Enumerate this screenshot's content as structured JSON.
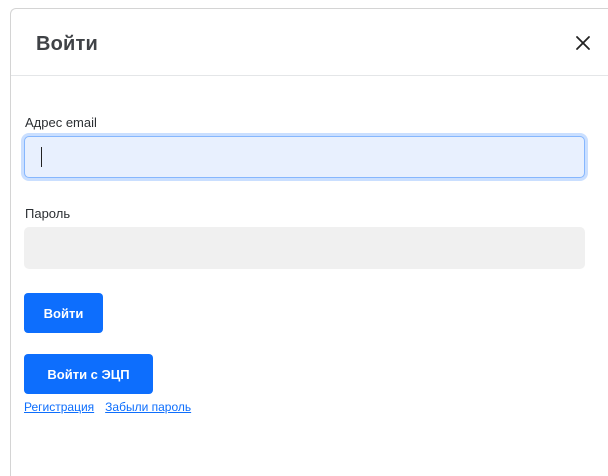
{
  "modal": {
    "title": "Войти",
    "close_icon": "close-icon"
  },
  "form": {
    "email_label": "Адрес email",
    "email_value": "",
    "password_label": "Пароль",
    "password_value": "",
    "login_button": "Войти",
    "login_ecp_button": "Войти с ЭЦП"
  },
  "links": {
    "register": "Регистрация",
    "forgot_password": "Забыли пароль"
  },
  "colors": {
    "primary": "#0d6efd",
    "email_field_bg": "#e8f0fe",
    "password_field_bg": "#f0f0f0"
  }
}
